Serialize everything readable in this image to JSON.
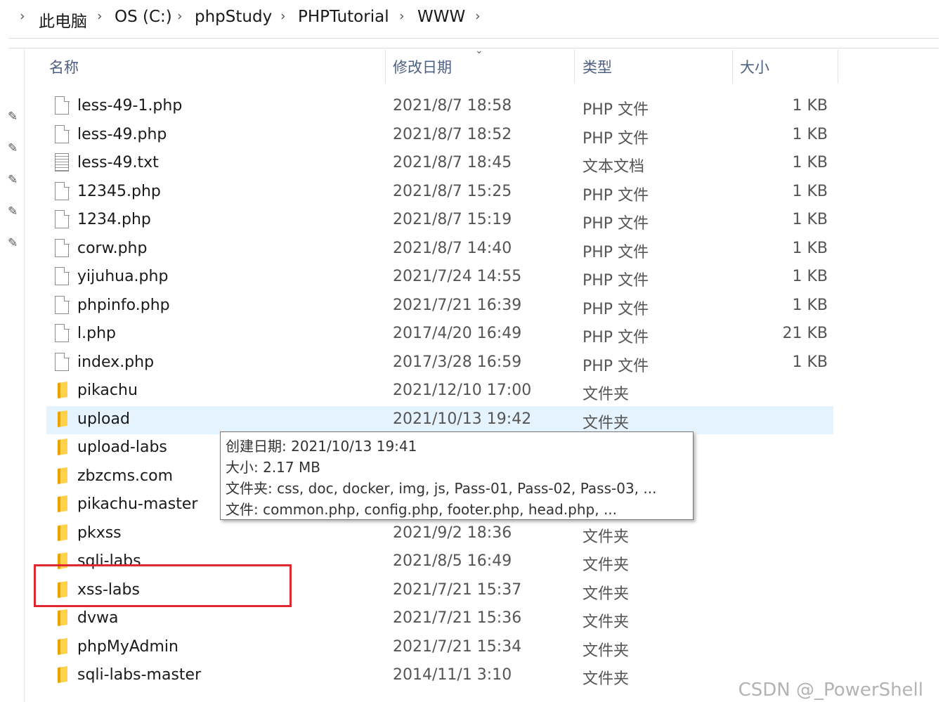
{
  "breadcrumb": {
    "items": [
      "此电脑",
      "OS (C:)",
      "phpStudy",
      "PHPTutorial",
      "WWW"
    ]
  },
  "columns": {
    "name": "名称",
    "date": "修改日期",
    "type": "类型",
    "size": "大小"
  },
  "files": [
    {
      "name": "less-49-1.php",
      "date": "2021/8/7 18:58",
      "type": "PHP 文件",
      "size": "1 KB",
      "icon": "php-file-icon"
    },
    {
      "name": "less-49.php",
      "date": "2021/8/7 18:52",
      "type": "PHP 文件",
      "size": "1 KB",
      "icon": "php-file-icon"
    },
    {
      "name": "less-49.txt",
      "date": "2021/8/7 18:45",
      "type": "文本文档",
      "size": "1 KB",
      "icon": "text-file-icon"
    },
    {
      "name": "12345.php",
      "date": "2021/8/7 15:25",
      "type": "PHP 文件",
      "size": "1 KB",
      "icon": "php-file-icon"
    },
    {
      "name": "1234.php",
      "date": "2021/8/7 15:19",
      "type": "PHP 文件",
      "size": "1 KB",
      "icon": "php-file-icon"
    },
    {
      "name": "corw.php",
      "date": "2021/8/7 14:40",
      "type": "PHP 文件",
      "size": "1 KB",
      "icon": "php-file-icon"
    },
    {
      "name": "yijuhua.php",
      "date": "2021/7/24 14:55",
      "type": "PHP 文件",
      "size": "1 KB",
      "icon": "php-file-icon"
    },
    {
      "name": "phpinfo.php",
      "date": "2021/7/21 16:39",
      "type": "PHP 文件",
      "size": "1 KB",
      "icon": "php-file-icon"
    },
    {
      "name": "l.php",
      "date": "2017/4/20 16:49",
      "type": "PHP 文件",
      "size": "21 KB",
      "icon": "php-file-icon"
    },
    {
      "name": "index.php",
      "date": "2017/3/28 16:59",
      "type": "PHP 文件",
      "size": "1 KB",
      "icon": "php-file-icon"
    },
    {
      "name": "pikachu",
      "date": "2021/12/10 17:00",
      "type": "文件夹",
      "size": "",
      "icon": "folder-icon"
    },
    {
      "name": "upload",
      "date": "2021/10/13 19:42",
      "type": "文件夹",
      "size": "",
      "icon": "folder-icon",
      "selected": true
    },
    {
      "name": "upload-labs",
      "date": "",
      "type": "",
      "size": "",
      "icon": "folder-icon"
    },
    {
      "name": "zbzcms.com",
      "date": "",
      "type": "",
      "size": "",
      "icon": "folder-icon"
    },
    {
      "name": "pikachu-master",
      "date": "",
      "type": "",
      "size": "",
      "icon": "folder-icon"
    },
    {
      "name": "pkxss",
      "date": "2021/9/2 18:36",
      "type": "文件夹",
      "size": "",
      "icon": "folder-icon"
    },
    {
      "name": "sqli-labs",
      "date": "2021/8/5 16:49",
      "type": "文件夹",
      "size": "",
      "icon": "folder-icon"
    },
    {
      "name": "xss-labs",
      "date": "2021/7/21 15:37",
      "type": "文件夹",
      "size": "",
      "icon": "folder-icon"
    },
    {
      "name": "dvwa",
      "date": "2021/7/21 15:36",
      "type": "文件夹",
      "size": "",
      "icon": "folder-icon"
    },
    {
      "name": "phpMyAdmin",
      "date": "2021/7/21 15:34",
      "type": "文件夹",
      "size": "",
      "icon": "folder-icon"
    },
    {
      "name": "sqli-labs-master",
      "date": "2014/11/1 3:10",
      "type": "文件夹",
      "size": "",
      "icon": "folder-icon"
    }
  ],
  "tooltip": {
    "lines": [
      "创建日期: 2021/10/13 19:41",
      "大小: 2.17 MB",
      "文件夹: css, doc, docker, img, js, Pass-01, Pass-02, Pass-03, ...",
      "文件: common.php, config.php, footer.php, head.php, ..."
    ]
  },
  "annotation": {
    "color": "#e0282e"
  },
  "colors": {
    "selected_row": "#e5f3ff",
    "header_text": "#4d6082",
    "folder": "#ffd04a"
  },
  "watermark": "CSDN @_PowerShell"
}
